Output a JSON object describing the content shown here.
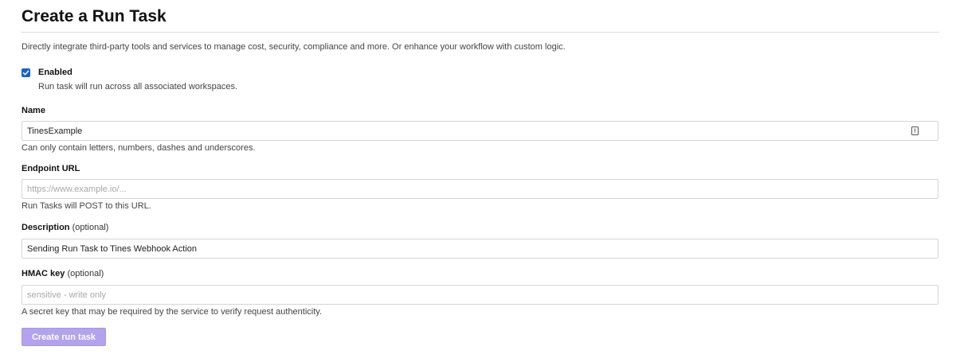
{
  "page": {
    "title": "Create a Run Task",
    "intro": "Directly integrate third-party tools and services to manage cost, security, compliance and more. Or enhance your workflow with custom logic."
  },
  "enabled": {
    "label": "Enabled",
    "help": "Run task will run across all associated workspaces.",
    "checked": true
  },
  "name_field": {
    "label": "Name",
    "value": "TinesExample",
    "help": "Can only contain letters, numbers, dashes and underscores."
  },
  "endpoint_field": {
    "label": "Endpoint URL",
    "placeholder": "https://www.example.io/...",
    "help": "Run Tasks will POST to this URL."
  },
  "description_field": {
    "label": "Description",
    "optional": "(optional)",
    "value": "Sending Run Task to Tines Webhook Action"
  },
  "hmac_field": {
    "label": "HMAC key",
    "optional": "(optional)",
    "placeholder": "sensitive - write only",
    "help": "A secret key that may be required by the service to verify request authenticity."
  },
  "submit": {
    "label": "Create run task"
  },
  "colors": {
    "checkbox": "#1563d1",
    "button": "#b3a3ee"
  }
}
